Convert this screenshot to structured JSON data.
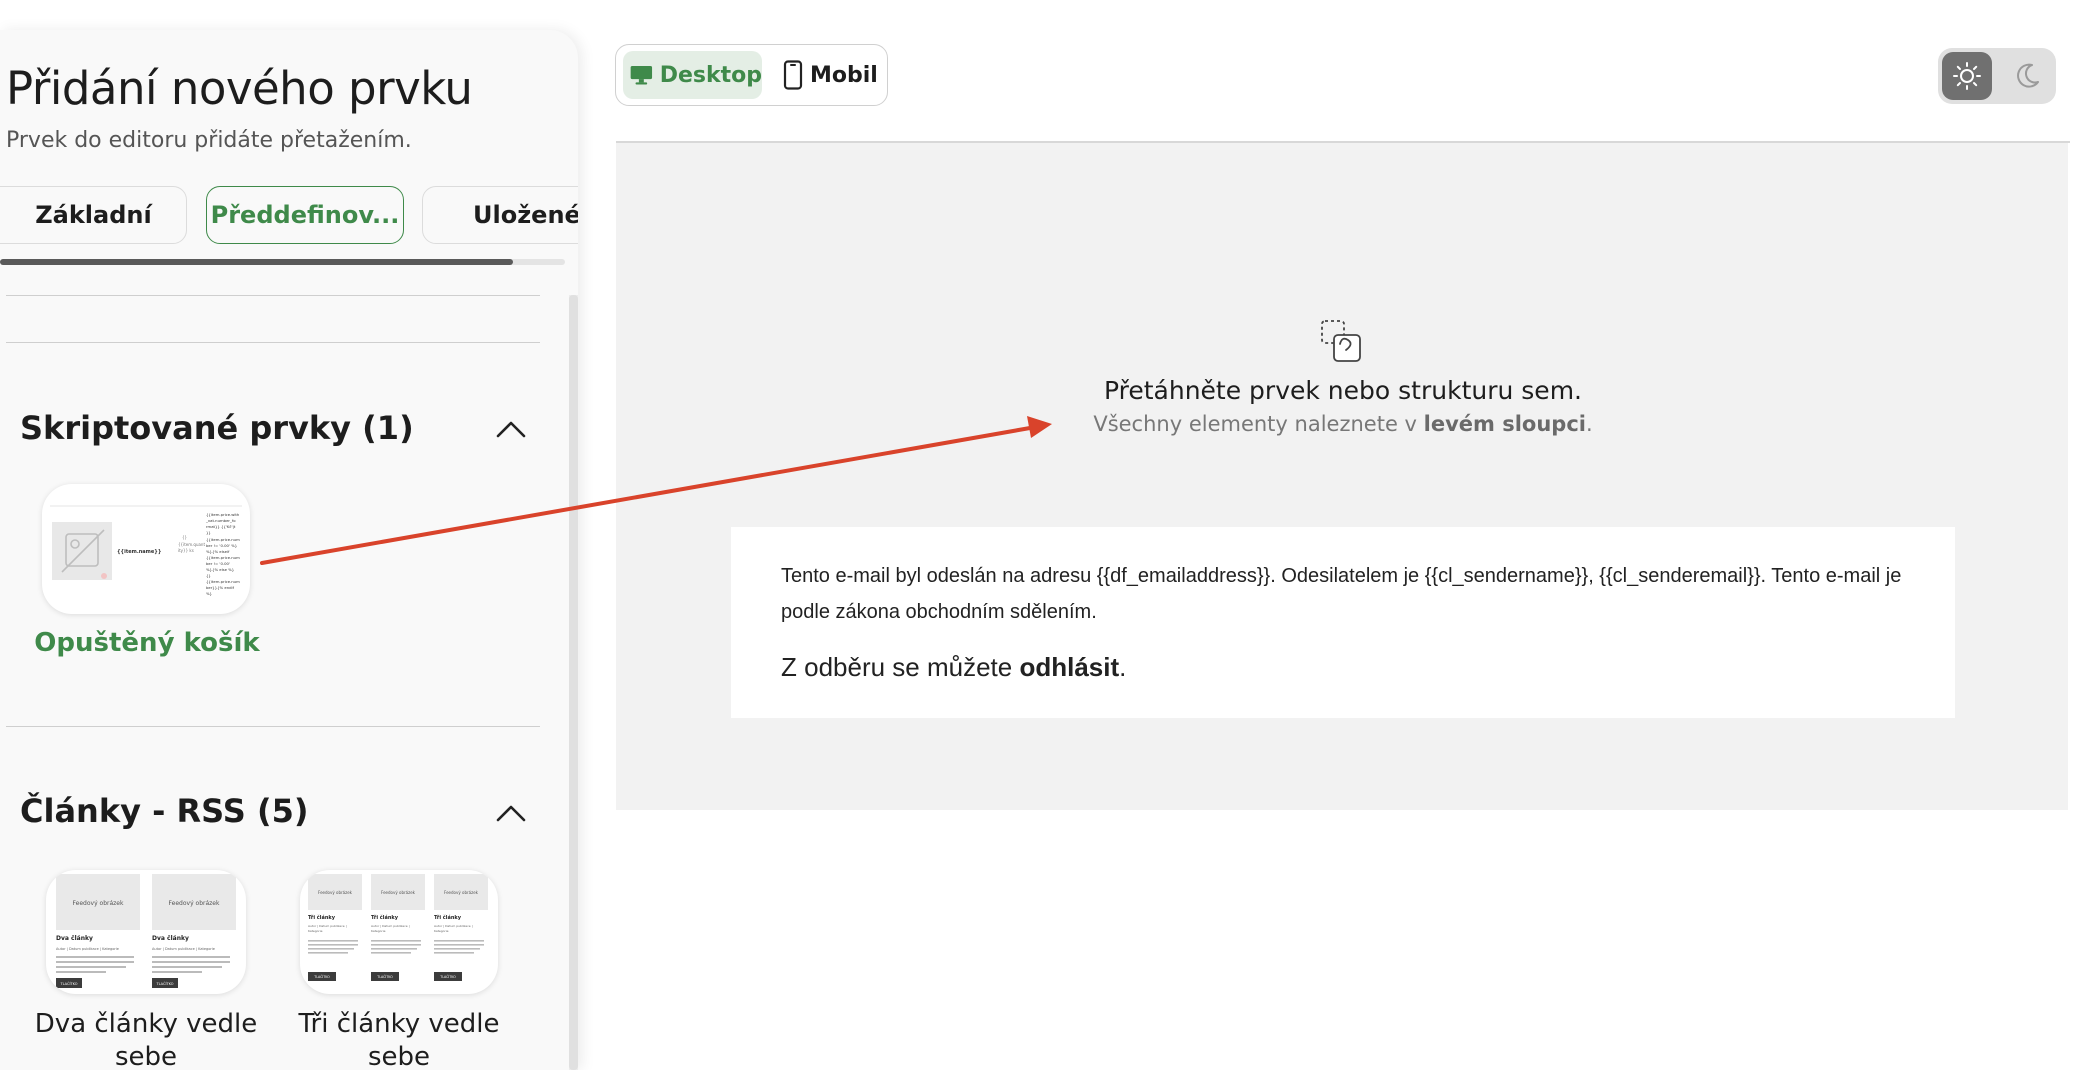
{
  "panel": {
    "title": "Přidání nového prvku",
    "subtitle": "Prvek do editoru přidáte přetažením.",
    "tabs": [
      {
        "label": "Základní"
      },
      {
        "label": "Předdefinov..."
      },
      {
        "label": "Uložené"
      }
    ],
    "sections": [
      {
        "title": "Skriptované prvky (1)",
        "items": [
          {
            "label": "Opuštěný košík"
          }
        ]
      },
      {
        "title": "Články - RSS (5)",
        "items": [
          {
            "label": "Dva články vedle sebe",
            "thumb_image_label": "Feedový obrázek",
            "thumb_heading": "Dva články",
            "thumb_button": "TLAČÍTKO"
          },
          {
            "label": "Tři články vedle sebe",
            "thumb_image_label": "Feedový obrázek",
            "thumb_heading": "Tři články",
            "thumb_button": "TLAČÍTKO"
          }
        ]
      }
    ]
  },
  "view_toggle": {
    "desktop": "Desktop",
    "mobile": "Mobil",
    "selected": "Desktop"
  },
  "theme": {
    "light_icon": "sun-icon",
    "dark_icon": "moon-icon",
    "selected": "light"
  },
  "canvas": {
    "drop_title": "Přetáhněte prvek nebo strukturu sem.",
    "drop_sub_prefix": "Všechny elementy naleznete v ",
    "drop_sub_bold": "levém sloupci",
    "drop_sub_suffix": ".",
    "footer_text": "Tento e-mail byl odeslán na adresu {{df_emailaddress}}. Odesilatelem je {{cl_sendername}}, {{cl_senderemail}}. Tento e-mail je podle zákona obchodním sdělením.",
    "unsubscribe_prefix": "Z odběru se můžete ",
    "unsubscribe_link": "odhlásit",
    "unsubscribe_suffix": "."
  },
  "colors": {
    "accent_green": "#3f8a4a",
    "arrow_red": "#d9432b",
    "canvas_bg": "#f2f2f2"
  }
}
